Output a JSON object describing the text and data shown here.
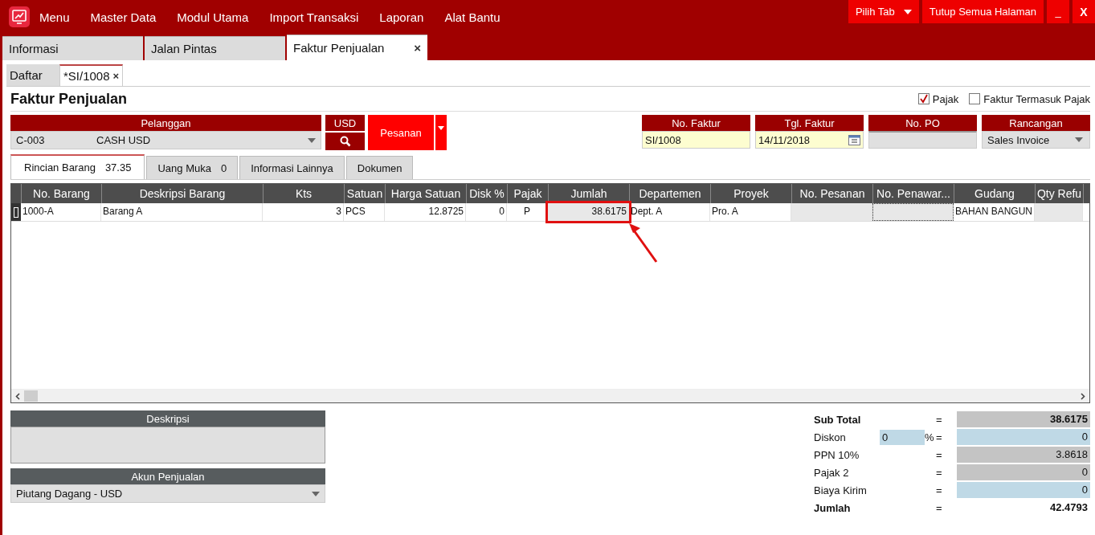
{
  "menu_bar": {
    "items": [
      "Menu",
      "Master Data",
      "Modul Utama",
      "Import Transaksi",
      "Laporan",
      "Alat Bantu"
    ],
    "pick_tab": "Pilih Tab",
    "close_all": "Tutup Semua Halaman",
    "minimize": "_",
    "close": "X"
  },
  "main_tabs": [
    {
      "label": "Informasi",
      "selected": false
    },
    {
      "label": "Jalan Pintas",
      "selected": false
    },
    {
      "label": "Faktur Penjualan",
      "selected": true,
      "close": "×"
    }
  ],
  "sub_tabs": [
    {
      "label": "Daftar",
      "selected": false
    },
    {
      "label": "*SI/1008",
      "selected": true,
      "close": "×"
    }
  ],
  "form": {
    "title": "Faktur Penjualan",
    "checkboxes": [
      {
        "label": "Pajak",
        "checked": true
      },
      {
        "label": "Faktur Termasuk Pajak",
        "checked": false
      }
    ],
    "customer": {
      "header": "Pelanggan",
      "code": "C-003",
      "name": "CASH USD"
    },
    "currency": "USD",
    "order_button": "Pesanan",
    "fields": [
      {
        "header": "No. Faktur",
        "value": "SI/1008",
        "kind": "text"
      },
      {
        "header": "Tgl. Faktur",
        "value": "14/11/2018",
        "kind": "date"
      },
      {
        "header": "No. PO",
        "kind": "readonly"
      },
      {
        "header": "Rancangan",
        "value": "Sales Invoice",
        "kind": "dropdown"
      }
    ]
  },
  "detail_tabs": [
    {
      "label": "Rincian Barang",
      "count": "37.35",
      "selected": true
    },
    {
      "label": "Uang Muka",
      "count": "0",
      "selected": false
    },
    {
      "label": "Informasi Lainnya",
      "selected": false
    },
    {
      "label": "Dokumen",
      "selected": false
    }
  ],
  "table": {
    "columns": [
      {
        "label": "No. Barang",
        "readonly": false,
        "highlighted": false,
        "focused": false
      },
      {
        "label": "Deskripsi Barang",
        "readonly": false,
        "highlighted": false,
        "focused": false
      },
      {
        "label": "Kts",
        "readonly": false,
        "highlighted": false,
        "focused": false
      },
      {
        "label": "Satuan",
        "readonly": false,
        "highlighted": false,
        "focused": false
      },
      {
        "label": "Harga Satuan",
        "readonly": false,
        "highlighted": false,
        "focused": false
      },
      {
        "label": "Disk %",
        "readonly": false,
        "highlighted": false,
        "focused": false
      },
      {
        "label": "Pajak",
        "readonly": false,
        "highlighted": false,
        "focused": false
      },
      {
        "label": "Jumlah",
        "readonly": true,
        "highlighted": true,
        "focused": false
      },
      {
        "label": "Departemen",
        "readonly": false,
        "highlighted": false,
        "focused": false
      },
      {
        "label": "Proyek",
        "readonly": false,
        "highlighted": false,
        "focused": false
      },
      {
        "label": "No. Pesanan",
        "readonly": true,
        "highlighted": false,
        "focused": false
      },
      {
        "label": "No. Penawar...",
        "readonly": true,
        "highlighted": false,
        "focused": true
      },
      {
        "label": "Gudang",
        "readonly": false,
        "highlighted": false,
        "focused": false
      },
      {
        "label": "Qty Refu",
        "readonly": true,
        "highlighted": false,
        "focused": false
      }
    ],
    "rows": [
      {
        "cells": [
          "1000-A",
          "Barang A",
          "3",
          "PCS",
          "12.8725",
          "0",
          "P",
          "38.6175",
          "Dept. A",
          "Pro. A",
          "",
          "",
          "BAHAN BANGUN",
          ""
        ]
      }
    ]
  },
  "description": {
    "header": "Deskripsi"
  },
  "sales_account": {
    "header": "Akun Penjualan",
    "value": "Piutang Dagang - USD"
  },
  "totals": [
    {
      "label": "Sub Total",
      "value": "38.6175",
      "kind": "subtotal"
    },
    {
      "label": "Diskon",
      "percent": "0",
      "percent_sign": "%",
      "value": "0",
      "kind": "editable"
    },
    {
      "label": "PPN 10%",
      "value": "3.8618",
      "kind": "readonly"
    },
    {
      "label": "Pajak 2",
      "value": "0",
      "kind": "readonly"
    },
    {
      "label": "Biaya Kirim",
      "value": "0",
      "kind": "editable"
    },
    {
      "label": "Jumlah",
      "value": "42.4793",
      "kind": "grand"
    }
  ],
  "equals": "="
}
